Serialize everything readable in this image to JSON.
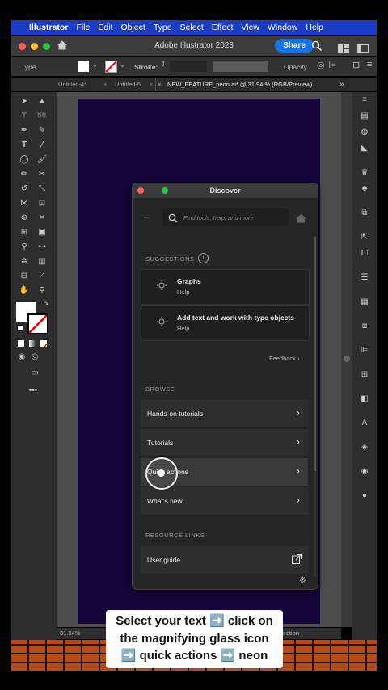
{
  "menubar": {
    "app": "Illustrator",
    "items": [
      "File",
      "Edit",
      "Object",
      "Type",
      "Select",
      "Effect",
      "View",
      "Window",
      "Help"
    ]
  },
  "window": {
    "title": "Adobe Illustrator 2023",
    "share_label": "Share"
  },
  "controlbar": {
    "type_label": "Type",
    "stroke_label": "Stroke:",
    "opacity_label": "Opacity"
  },
  "tabs": [
    {
      "label": "Untitled-4*"
    },
    {
      "label": "Untitled-5"
    },
    {
      "label": "NEW_FEATURE_neon.ai* @ 31.94 % (RGB/Preview)",
      "active": true
    }
  ],
  "status": {
    "zoom": "31.94%",
    "right_fragment": "ection"
  },
  "discover": {
    "title": "Discover",
    "search_placeholder": "Find tools, help, and more",
    "suggestions_label": "SUGGESTIONS",
    "suggestions": [
      {
        "title": "Graphs",
        "subtitle": "Help"
      },
      {
        "title": "Add text and work with type objects",
        "subtitle": "Help"
      }
    ],
    "feedback_label": "Feedback",
    "browse_label": "BROWSE",
    "browse_items": [
      {
        "label": "Hands-on tutorials"
      },
      {
        "label": "Tutorials"
      },
      {
        "label": "Quick actions"
      },
      {
        "label": "What's new"
      }
    ],
    "resource_label": "RESOURCE LINKS",
    "resource_items": [
      {
        "label": "User guide"
      }
    ]
  },
  "caption": {
    "line1": "Select your text ➡️ click on",
    "line2": "the magnifying glass icon",
    "line3": "➡️ quick actions ➡️ neon"
  },
  "colors": {
    "menubar": "#1b3cc7",
    "share": "#1473e6",
    "artboard": "#14063a",
    "traffic_red": "#ff5f57",
    "traffic_yellow": "#febc2e",
    "traffic_green": "#28c840"
  }
}
